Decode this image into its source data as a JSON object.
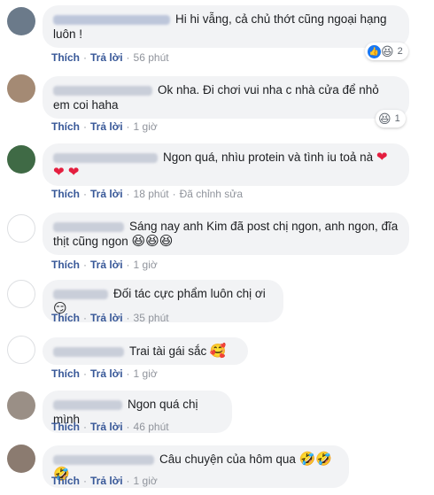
{
  "actions": {
    "like": "Thích",
    "reply": "Trả lời",
    "separator": "·"
  },
  "comments": [
    {
      "name": "Hoang Tu Mai Huong",
      "text": "Hi hi vẫng, cả chủ thớt cũng ngoại hạng luôn !",
      "time": "56 phút",
      "edited": "",
      "reactions": "😆",
      "reaction_count": "2",
      "reaction_icons": [
        "like-icon",
        "laughing-emoji-icon"
      ]
    },
    {
      "name": "Le Bao Trung Hieu",
      "text": "Ok nha. Đi chơi vui nha c nhà cửa để nhỏ em coi haha",
      "time": "1 giờ",
      "edited": "",
      "reactions": "😆",
      "reaction_count": "1"
    },
    {
      "name": "Thanh Nguyen Anh",
      "text": "Ngon quá, nhìu protein và tình iu toả nà",
      "emoji": "❤ ❤ ❤",
      "time": "18 phút",
      "edited": "Đã chỉnh sửa"
    },
    {
      "name": "Minh Nguyen",
      "text": "Sáng nay anh Kim đã post chị ngon, anh ngon, đĩa thịt cũng ngon",
      "emoji": "😆😆😆",
      "time": "1 giờ"
    },
    {
      "name": "Trung Tran",
      "text": "Đối tác cực phẩm luôn chị ơi",
      "emoji": "😏",
      "time": "35 phút"
    },
    {
      "name": "Nguyen Anh Lam",
      "text": "Trai tài gái sắc",
      "emoji": "🥰",
      "time": "1 giờ"
    },
    {
      "name": "Nguyen Chi",
      "text": "Ngon quá chị mình",
      "time": "46 phút"
    },
    {
      "name": "Nguyen Thanh Hieu",
      "text": "Câu chuyện của hôm qua",
      "emoji": "🤣🤣🤣",
      "time": "1 giờ"
    }
  ],
  "colors": {
    "bubble": "#f2f3f5",
    "link": "#385898",
    "meta": "#90949c",
    "heart": "#e41e3f",
    "like_blue": "#1877f2"
  }
}
